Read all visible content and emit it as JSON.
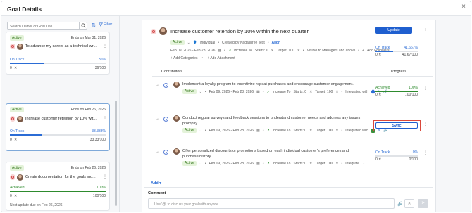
{
  "window": {
    "title": "Goal Details",
    "close_glyph": "×"
  },
  "sidebar": {
    "search_placeholder": "Search Owner or Goal Title",
    "filter_label": "Filter",
    "cards": [
      {
        "status_badge": "Active",
        "ends": "Ends on Mar 31, 2026",
        "title": "To advance my career as a technical wri...",
        "status": "On Track",
        "percent": "36%",
        "progress": 0.36,
        "status_color": "#2b6cd5",
        "start": "0",
        "value": "36/100"
      },
      {
        "status_badge": "Active",
        "ends": "Ends on Feb 26, 2026",
        "title": "Increase customer retention by 10% wit...",
        "status": "On Track",
        "percent": "33.333%",
        "progress": 0.33333,
        "status_color": "#2b6cd5",
        "start": "0",
        "value": "33.33/100"
      },
      {
        "status_badge": "Active",
        "ends": "Ends on Feb 26, 2026",
        "title": "Create documentation for the goals mo...",
        "status": "Achieved",
        "percent": "100%",
        "progress": 1.0,
        "status_color": "#2e8b2e",
        "start": "0",
        "value": "100/100",
        "next_update": "Next update due on Feb 26, 2026"
      }
    ]
  },
  "goal": {
    "title": "Increase customer retention by 10% within the next quarter.",
    "status_badge": "Active",
    "type": "Individual",
    "created_by": "Created by Nagashree Test",
    "align_label": "Align",
    "date_range": "Feb 09, 2026 - Feb 28, 2026",
    "metric": "Increase To",
    "starts": "Starts: 0",
    "target": "Target: 100",
    "visibility": "Visible to Managers and above",
    "add_followers": "Add Followers",
    "add_categories": "Add Categories",
    "add_attachment": "Add Attachment",
    "update_button": "Update",
    "progress_status": "On Track",
    "progress_percent": "41.667%",
    "progress": 0.41667,
    "progress_start": "0",
    "progress_value": "41.67/100"
  },
  "contributors": {
    "header_left": "Contributors",
    "header_right": "Progress",
    "rows": [
      {
        "title": "Implement a loyalty program to incentivize repeat purchases and encourage customer engagement.",
        "status_badge": "Active",
        "date_range": "Feb 09, 2026 - Feb 28, 2026",
        "metric": "Increase To",
        "starts": "Starts: 0",
        "target": "Target: 100",
        "integration": "Integrated with",
        "progress_status": "Achieved",
        "progress_percent": "100%",
        "progress": 1.0,
        "progress_start": "0",
        "progress_value": "100/100",
        "status_color": "#2e8b2e"
      },
      {
        "title": "Conduct regular surveys and feedback sessions to understand customer needs and address any issues promptly.",
        "status_badge": "Active",
        "date_range": "Feb 09, 2026 - Feb 28, 2026",
        "metric": "Increase To",
        "starts": "Starts: 0",
        "target": "Target: 100",
        "integration": "Integrated with",
        "sync_button": "Sync"
      },
      {
        "title": "Offer personalized discounts or promotions based on each individual customer's preferences and purchase history.",
        "status_badge": "Active",
        "date_range": "Feb 09, 2026 - Feb 28, 2026",
        "metric": "Increase To",
        "starts": "Starts: 0",
        "target": "Target: 100",
        "integration": "Integrate",
        "progress_status": "On Track",
        "progress_percent": "0%",
        "progress": 0.0,
        "progress_start": "0",
        "progress_value": "0/100",
        "status_color": "#2b6cd5"
      }
    ],
    "add_label": "Add"
  },
  "comment": {
    "label": "Comment",
    "placeholder": "Use '@' to discuss your goal with anyone"
  },
  "colors": {
    "primary": "#1f5fcf",
    "achieved": "#2e8b2e",
    "on_track": "#2b6cd5",
    "highlight_border": "#d9483b"
  }
}
